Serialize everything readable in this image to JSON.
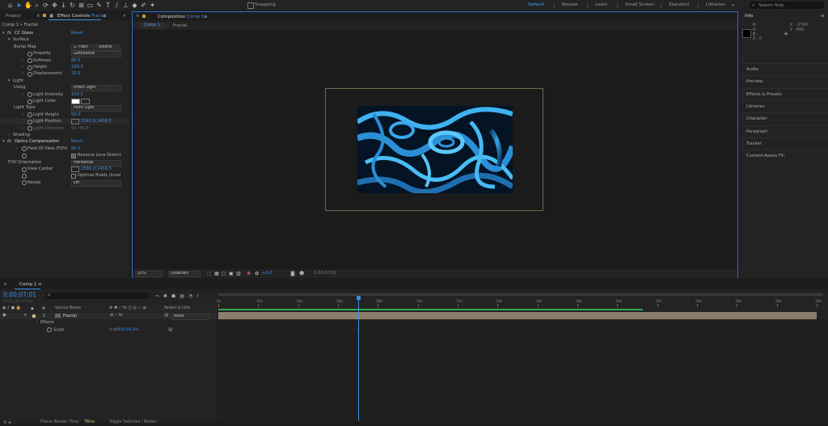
{
  "toolbar": {
    "snapping_label": "Snapping",
    "workspaces": [
      "Default",
      "Review",
      "Learn",
      "Small Screen",
      "Standard",
      "Libraries"
    ],
    "active_workspace": "Default",
    "search_placeholder": "Search Help",
    "icons": [
      "home-icon",
      "selection-tool-icon",
      "hand-tool-icon",
      "zoom-tool-icon",
      "orbit-tool-icon",
      "pan-tool-icon",
      "dolly-tool-icon",
      "rotate-tool-icon",
      "anchor-tool-icon",
      "shape-tool-icon",
      "pen-tool-icon",
      "type-tool-icon",
      "brush-tool-icon",
      "clone-tool-icon",
      "eraser-tool-icon",
      "roto-tool-icon",
      "puppet-tool-icon"
    ]
  },
  "left_panel": {
    "tab_project": "Project",
    "tab_effect_controls": "Effect Controls",
    "tab_effect_controls_layer": "Fractal",
    "breadcrumb": "Comp 1 • Fractal",
    "rows": [
      {
        "indent": 0,
        "label": "CC Glass",
        "fx": true,
        "value": "Reset",
        "value_type": "link"
      },
      {
        "indent": 1,
        "label": "Surface",
        "tri": "open"
      },
      {
        "indent": 2,
        "label": "Bump Map",
        "value": "1. Fract",
        "dd": true,
        "extra": "Source"
      },
      {
        "indent": 2,
        "label": "Property",
        "stopwatch": true,
        "value": "Luminance",
        "dd": true
      },
      {
        "indent": 2,
        "label": "Softness",
        "stopwatch": true,
        "tri": "closed",
        "value": "80.0",
        "value_type": "num"
      },
      {
        "indent": 2,
        "label": "Height",
        "stopwatch": true,
        "tri": "closed",
        "value": "100.0",
        "value_type": "num"
      },
      {
        "indent": 2,
        "label": "Displacement",
        "stopwatch": true,
        "tri": "closed",
        "value": "20.0",
        "value_type": "num"
      },
      {
        "indent": 1,
        "label": "Light",
        "tri": "open"
      },
      {
        "indent": 2,
        "label": "Using",
        "value": "Effect Light",
        "dd": true
      },
      {
        "indent": 2,
        "label": "Light Intensity",
        "stopwatch": true,
        "tri": "closed",
        "value": "150.0",
        "value_type": "num"
      },
      {
        "indent": 2,
        "label": "Light Color",
        "stopwatch": true,
        "swatch": true
      },
      {
        "indent": 2,
        "label": "Light Type",
        "value": "Point Light",
        "dd": true
      },
      {
        "indent": 2,
        "label": "Light Height",
        "stopwatch": true,
        "tri": "closed",
        "value": "50.0",
        "value_type": "num"
      },
      {
        "indent": 2,
        "label": "Light Position",
        "stopwatch": true,
        "value": "1541.9,1406.5",
        "value_type": "point",
        "highlight": true
      },
      {
        "indent": 2,
        "label": "Light Direction",
        "stopwatch": true,
        "tri": "closed",
        "value": "0x -45.0°",
        "value_type": "dim",
        "disabled": true
      },
      {
        "indent": 1,
        "label": "Shading",
        "tri": "closed"
      },
      {
        "indent": 0,
        "label": "Optics Compensation",
        "fx": true,
        "value": "Reset",
        "value_type": "link"
      },
      {
        "indent": 1,
        "label": "Field Of View (FOV)",
        "stopwatch": true,
        "tri": "closed",
        "value": "85.0",
        "value_type": "num"
      },
      {
        "indent": 1,
        "label": "",
        "stopwatch": true,
        "checkbox": true,
        "checked": true,
        "value": "Reverse Lens Distort"
      },
      {
        "indent": 1,
        "label": "FOV Orientation",
        "value": "Horizontal",
        "dd": true
      },
      {
        "indent": 1,
        "label": "View Center",
        "stopwatch": true,
        "value": "2580.0,1406.5",
        "value_type": "point"
      },
      {
        "indent": 1,
        "label": "",
        "stopwatch": true,
        "checkbox": true,
        "checked": false,
        "value": "Optimal Pixels (Inval"
      },
      {
        "indent": 1,
        "label": "Resize",
        "stopwatch": true,
        "value": "Off",
        "dd": true
      }
    ]
  },
  "comp_panel": {
    "tab_label": "Composition",
    "tab_comp_name": "Comp 1",
    "sub_tabs": [
      "Comp 1",
      "Fractal"
    ],
    "zoom": "25%",
    "resolution": "(Quarter)",
    "exposure": "+0.0",
    "timecode": "0;00;07;01"
  },
  "right_panel": {
    "info_label": "Info",
    "info_rgba": [
      "R :",
      "G :",
      "B :",
      "A : 0"
    ],
    "info_x": "X : -2740",
    "info_y": "Y : 848",
    "items": [
      "Audio",
      "Preview",
      "Effects & Presets",
      "Libraries",
      "Character",
      "Paragraph",
      "Tracker",
      "Content-Aware Fill"
    ]
  },
  "timeline": {
    "tab_label": "Comp 1",
    "timecode": "0;00;07;01",
    "timecode_sub": "00211 (29.97 fps)",
    "search_placeholder": "ρ",
    "col_source_name": "Source Name",
    "col_parent": "Parent & Link",
    "layer_number": "1",
    "layer_name": "Fractal",
    "layer_parent": "None",
    "effects_label": "Effects",
    "scale_label": "Scale",
    "scale_value": "54.0,54.0%",
    "ruler": [
      "0s",
      "02s",
      "04s",
      "06s",
      "08s",
      "10s",
      "12s",
      "14s",
      "16s",
      "18s",
      "20s",
      "22s",
      "24s",
      "26s",
      "28s",
      "30s"
    ],
    "playhead_seconds": 7.03,
    "duration_seconds": 30,
    "work_area_end_seconds": 21.3,
    "footer_render_label": "Frame Render Time:",
    "footer_render_value": "78ms",
    "footer_toggle": "Toggle Switches / Modes"
  },
  "colors": {
    "accent": "#3b8fe8",
    "layer_bar": "#8a7e6a",
    "work_area": "#2fa84f",
    "ruler_blue": "#2f6fd0"
  }
}
